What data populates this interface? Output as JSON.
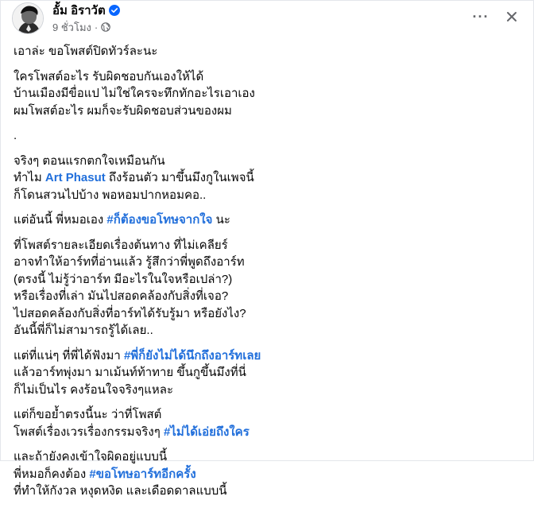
{
  "post": {
    "author": {
      "name": "อั้ม อิราวัต",
      "verified_icon": "verified-badge-icon",
      "avatar_icon": "profile-avatar"
    },
    "meta": {
      "time": "9 ชั่วโมง",
      "separator": "·",
      "audience_icon": "globe-icon"
    },
    "actions": {
      "more_icon": "more-options-icon",
      "more_label": "···",
      "close_icon": "close-icon"
    },
    "colors": {
      "link": "#216fdb",
      "text": "#050505",
      "secondary": "#65676b",
      "verified": "#0866ff"
    },
    "body": {
      "p1": {
        "l1": "เอาล่ะ ขอโพสต์ปิดทัวร์ละนะ"
      },
      "p2": {
        "l1": "ใครโพสต์อะไร รับผิดชอบกันเองให้ได้",
        "l2": "บ้านเมืองมีขื่อแป ไม่ใช่ใครจะทึกทักอะไรเอาเอง",
        "l3": "ผมโพสต์อะไร ผมก็จะรับผิดชอบส่วนของผม"
      },
      "p3": {
        "l1": "."
      },
      "p4": {
        "l1": "จริงๆ ตอนแรกตกใจเหมือนกัน",
        "l2_before": "ทำไม ",
        "l2_mention": "Art Phasut",
        "l2_after": " ถึงร้อนตัว มาขึ้นมึงกูในเพจนี้",
        "l3": "ก็โดนสวนไปบ้าง พอหอมปากหอมคอ.."
      },
      "p5": {
        "l1_before": "แต่อันนี้ พี่หมอเอง ",
        "l1_hashtag": "#ก็ต้องขอโทษจากใจ",
        "l1_after": " นะ"
      },
      "p6": {
        "l1": "ที่โพสต์รายละเอียดเรื่องต้นทาง ที่ไม่เคลียร์",
        "l2": "อาจทำให้อาร์ทที่อ่านแล้ว รู้สึกว่าพี่พูดถึงอาร์ท",
        "l3": "(ตรงนี้ ไม่รู้ว่าอาร์ท มีอะไรในใจหรือเปล่า?)",
        "l4": "หรือเรื่องที่เล่า มันไปสอดคล้องกับสิ่งที่เจอ?",
        "l5": "ไปสอดคล้องกับสิ่งที่อาร์ทได้รับรู้มา หรือยังไง?",
        "l6": "อันนี้พี่ก็ไม่สามารถรู้ได้เลย.."
      },
      "p7": {
        "l1_before": "แต่ที่แน่ๆ ที่พี่ได้ฟังมา ",
        "l1_hashtag": "#พี่ก็ยังไม่ได้นึกถึงอาร์ทเลย",
        "l2": "แล้วอาร์ทพุ่งมา มาเม้นท์ท้าทาย ขึ้นกูขึ้นมึงที่นี่",
        "l3": "ก็ไม่เป็นไร คงร้อนใจจริงๆแหละ"
      },
      "p8": {
        "l1": "แต่ก็ขอย้ำตรงนี้นะ ว่าที่โพสต์",
        "l2_before": "โพสต์เรื่องเวรเรื่องกรรมจริงๆ ",
        "l2_hashtag": "#ไม่ได้เอ่ยถึงใคร"
      },
      "p9": {
        "l1": "และถ้ายังคงเข้าใจผิดอยู่แบบนี้",
        "l2_before": "พี่หมอก็คงต้อง ",
        "l2_hashtag": "#ขอโทษอาร์ทอีกครั้ง",
        "l3": "ที่ทำให้กังวล หงุดหงิด และเดือดดาลแบบนี้"
      }
    }
  }
}
